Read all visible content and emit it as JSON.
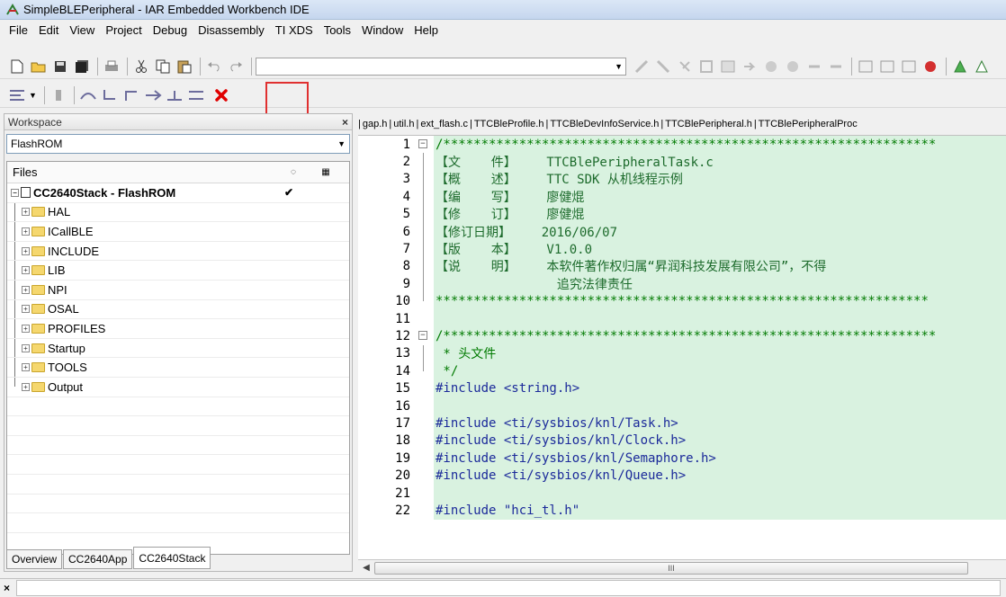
{
  "window": {
    "title": "SimpleBLEPeripheral - IAR Embedded Workbench IDE",
    "app_icon": "iar-app-icon"
  },
  "menu": [
    "File",
    "Edit",
    "View",
    "Project",
    "Debug",
    "Disassembly",
    "TI XDS",
    "Tools",
    "Window",
    "Help"
  ],
  "toolbar": {
    "combo_value": ""
  },
  "workspace": {
    "header": "Workspace",
    "close": "×",
    "configuration": "FlashROM",
    "files_header": "Files",
    "root": {
      "label": "CC2640Stack - FlashROM",
      "check": "✔"
    },
    "folders": [
      "HAL",
      "ICallBLE",
      "INCLUDE",
      "LIB",
      "NPI",
      "OSAL",
      "PROFILES",
      "Startup",
      "TOOLS",
      "Output"
    ],
    "tabs": [
      "Overview",
      "CC2640App",
      "CC2640Stack"
    ]
  },
  "editor": {
    "tabs": [
      "gap.h",
      "util.h",
      "ext_flash.c",
      "TTCBleProfile.h",
      "TTCBleDevInfoService.h",
      "TTCBlePeripheral.h",
      "TTCBlePeripheralProc"
    ],
    "lines": [
      {
        "n": "1",
        "text": "/*****************************************************************"
      },
      {
        "n": "2",
        "text": "【文    件】    TTCBlePeripheralTask.c"
      },
      {
        "n": "3",
        "text": "【概    述】    TTC SDK 从机线程示例"
      },
      {
        "n": "4",
        "text": "【编    写】    廖健焜"
      },
      {
        "n": "5",
        "text": "【修    订】    廖健焜"
      },
      {
        "n": "6",
        "text": "【修订日期】    2016/06/07"
      },
      {
        "n": "7",
        "text": "【版    本】    V1.0.0"
      },
      {
        "n": "8",
        "text": "【说    明】    本软件著作权归属“昇润科技发展有限公司”，不得"
      },
      {
        "n": "9",
        "text": "                追究法律责任"
      },
      {
        "n": "10",
        "text": "*****************************************************************"
      },
      {
        "n": "11",
        "text": ""
      },
      {
        "n": "12",
        "text": "/*****************************************************************"
      },
      {
        "n": "13",
        "text": " * 头文件"
      },
      {
        "n": "14",
        "text": " */"
      },
      {
        "n": "15",
        "text": "#include <string.h>"
      },
      {
        "n": "16",
        "text": ""
      },
      {
        "n": "17",
        "text": "#include <ti/sysbios/knl/Task.h>"
      },
      {
        "n": "18",
        "text": "#include <ti/sysbios/knl/Clock.h>"
      },
      {
        "n": "19",
        "text": "#include <ti/sysbios/knl/Semaphore.h>"
      },
      {
        "n": "20",
        "text": "#include <ti/sysbios/knl/Queue.h>"
      },
      {
        "n": "21",
        "text": ""
      },
      {
        "n": "22",
        "text": "#include \"hci_tl.h\""
      }
    ],
    "scroll_thumb": "III"
  },
  "bottom": {
    "close": "×"
  }
}
